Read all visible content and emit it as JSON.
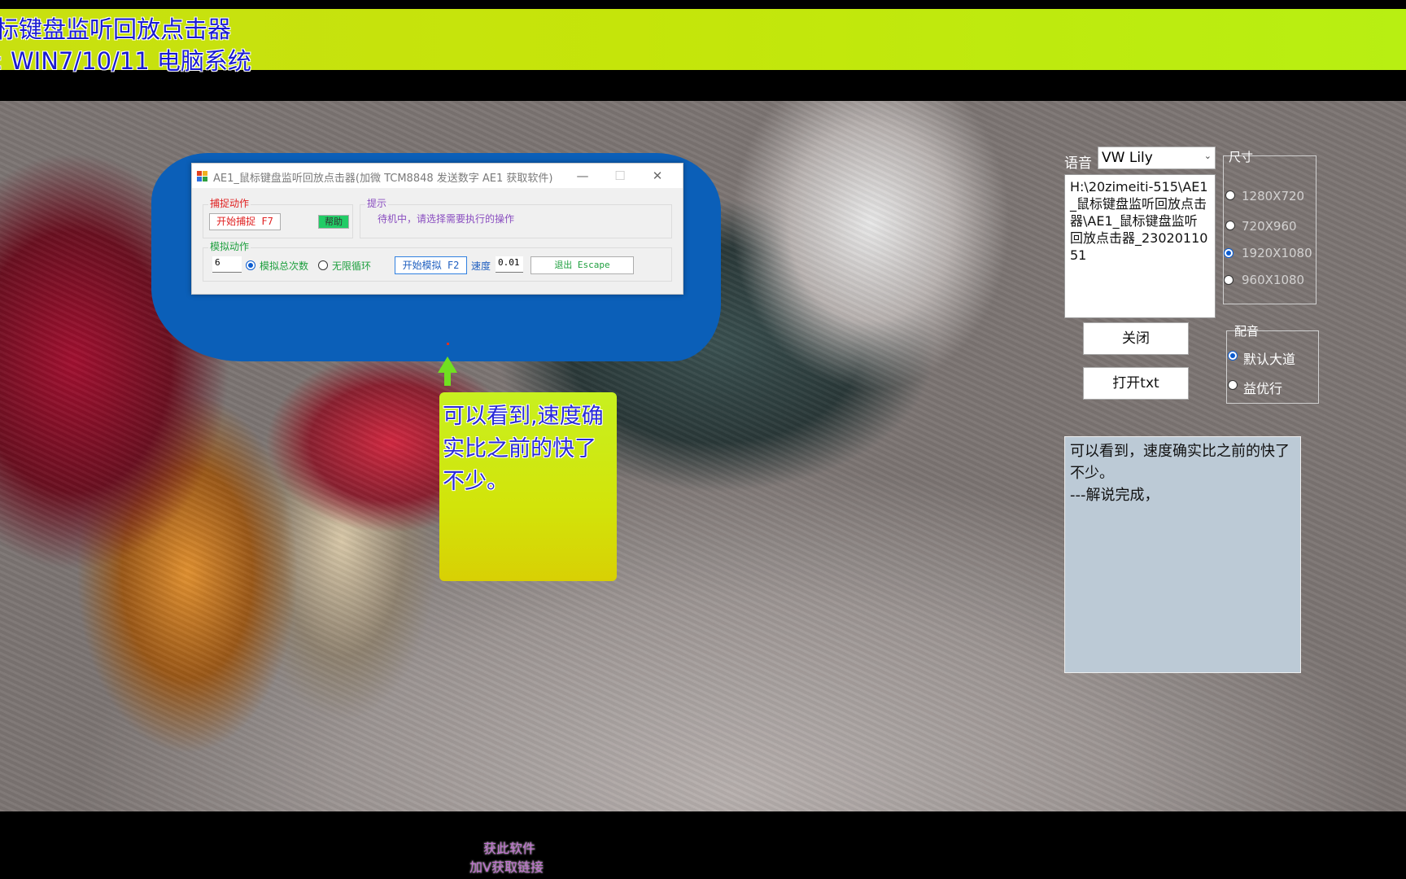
{
  "banner": {
    "line1": "标键盘监听回放点击器",
    "line2": ": WIN7/10/11 电脑系统"
  },
  "app_window": {
    "title": "AE1_鼠标键盘监听回放点击器(加微 TCM8848 发送数字 AE1 获取软件)",
    "minimize_glyph": "—",
    "maximize_glyph": "☐",
    "close_glyph": "✕",
    "capture_group": {
      "label": "捕捉动作",
      "start_capture_button": "开始捕捉 F7",
      "help_button": "帮助"
    },
    "hint_group": {
      "label": "提示",
      "text": "待机中，请选择需要执行的操作"
    },
    "simulate_group": {
      "label": "模拟动作",
      "count_value": "6",
      "radio_total": "模拟总次数",
      "radio_loop": "无限循环",
      "start_simulate_button": "开始模拟 F2",
      "speed_label": "速度",
      "speed_value": "0.01",
      "exit_button": "退出 Escape"
    },
    "colors": {
      "capture_label": "#e02020",
      "hint_label": "#8a4ec0",
      "sim_label": "#20a040",
      "help_bg": "#22cc66"
    }
  },
  "note": {
    "text": "可以看到,速度确实比之前的快了不少。"
  },
  "side_panel": {
    "voice_label": "语音",
    "voice_value": "VW Lily",
    "path_text": "H:\\20zimeiti-515\\AE1_鼠标键盘监听回放点击器\\AE1_鼠标键盘监听回放点击器_2302011051",
    "resolution_group_label": "尺寸",
    "resolutions": [
      {
        "label": "1280X720",
        "selected": false
      },
      {
        "label": "720X960",
        "selected": false
      },
      {
        "label": "1920X1080",
        "selected": true
      },
      {
        "label": "960X1080",
        "selected": false
      }
    ],
    "close_button": "关闭",
    "open_txt_button": "打开txt",
    "dub_group_label": "配音",
    "dub_options": [
      {
        "label": "默认大道",
        "selected": true
      },
      {
        "label": "益优行",
        "selected": false
      }
    ],
    "narration_text": "可以看到，速度确实比之前的快了不少。\n---解说完成，"
  },
  "footer": {
    "line1": "获此软件",
    "line2": "加V获取链接"
  }
}
